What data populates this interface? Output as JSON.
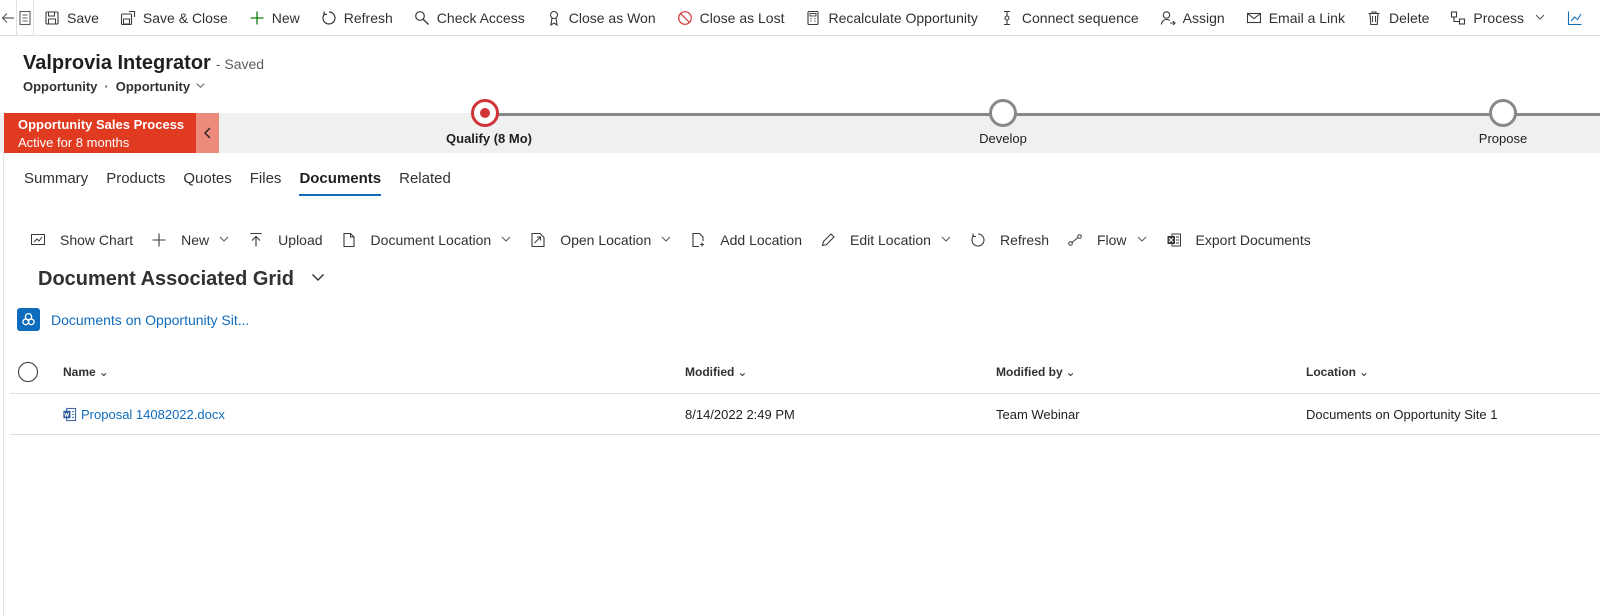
{
  "command_bar": {
    "items": [
      {
        "label": "Save",
        "icon": "save-icon"
      },
      {
        "label": "Save & Close",
        "icon": "save-close-icon"
      },
      {
        "label": "New",
        "icon": "plus-icon"
      },
      {
        "label": "Refresh",
        "icon": "refresh-icon"
      },
      {
        "label": "Check Access",
        "icon": "key-search-icon"
      },
      {
        "label": "Close as Won",
        "icon": "ribbon-icon"
      },
      {
        "label": "Close as Lost",
        "icon": "prohibited-icon"
      },
      {
        "label": "Recalculate Opportunity",
        "icon": "calculator-icon"
      },
      {
        "label": "Connect sequence",
        "icon": "sequence-icon"
      },
      {
        "label": "Assign",
        "icon": "assign-person-icon"
      },
      {
        "label": "Email a Link",
        "icon": "email-link-icon"
      },
      {
        "label": "Delete",
        "icon": "trash-icon"
      },
      {
        "label": "Process",
        "icon": "process-icon"
      }
    ]
  },
  "header": {
    "title": "Valprovia Integrator",
    "save_status": "- Saved",
    "entity": "Opportunity",
    "separator": "·",
    "form": "Opportunity"
  },
  "bpf": {
    "process_name": "Opportunity Sales Process",
    "active_for": "Active for 8 months",
    "stages": [
      {
        "label": "Qualify  (8 Mo)",
        "state": "active"
      },
      {
        "label": "Develop",
        "state": "pending"
      },
      {
        "label": "Propose",
        "state": "pending"
      }
    ]
  },
  "tabs": [
    {
      "label": "Summary",
      "selected": false
    },
    {
      "label": "Products",
      "selected": false
    },
    {
      "label": "Quotes",
      "selected": false
    },
    {
      "label": "Files",
      "selected": false
    },
    {
      "label": "Documents",
      "selected": true
    },
    {
      "label": "Related",
      "selected": false
    }
  ],
  "subgrid_commands": [
    {
      "label": "Show Chart",
      "icon": "chart-icon"
    },
    {
      "label": "New",
      "icon": "plus-icon"
    },
    {
      "label": "Upload",
      "icon": "upload-icon"
    },
    {
      "label": "Document Location",
      "icon": "document-icon"
    },
    {
      "label": "Open Location",
      "icon": "open-folder-icon"
    },
    {
      "label": "Add Location",
      "icon": "add-document-icon"
    },
    {
      "label": "Edit Location",
      "icon": "pencil-icon"
    },
    {
      "label": "Refresh",
      "icon": "refresh-icon"
    },
    {
      "label": "Flow",
      "icon": "flow-icon"
    },
    {
      "label": "Export Documents",
      "icon": "excel-icon"
    }
  ],
  "grid": {
    "title": "Document Associated Grid",
    "site_link": "Documents on Opportunity Sit...",
    "columns": [
      "Name",
      "Modified",
      "Modified by",
      "Location"
    ],
    "rows": [
      {
        "name": "Proposal 14082022.docx",
        "modified": "8/14/2022 2:49 PM",
        "modified_by": "Team Webinar",
        "location": "Documents on Opportunity Site 1"
      }
    ]
  },
  "colors": {
    "bpf_active": "#e03a21",
    "stage_active": "#d13438",
    "accent": "#0f6cbd"
  }
}
